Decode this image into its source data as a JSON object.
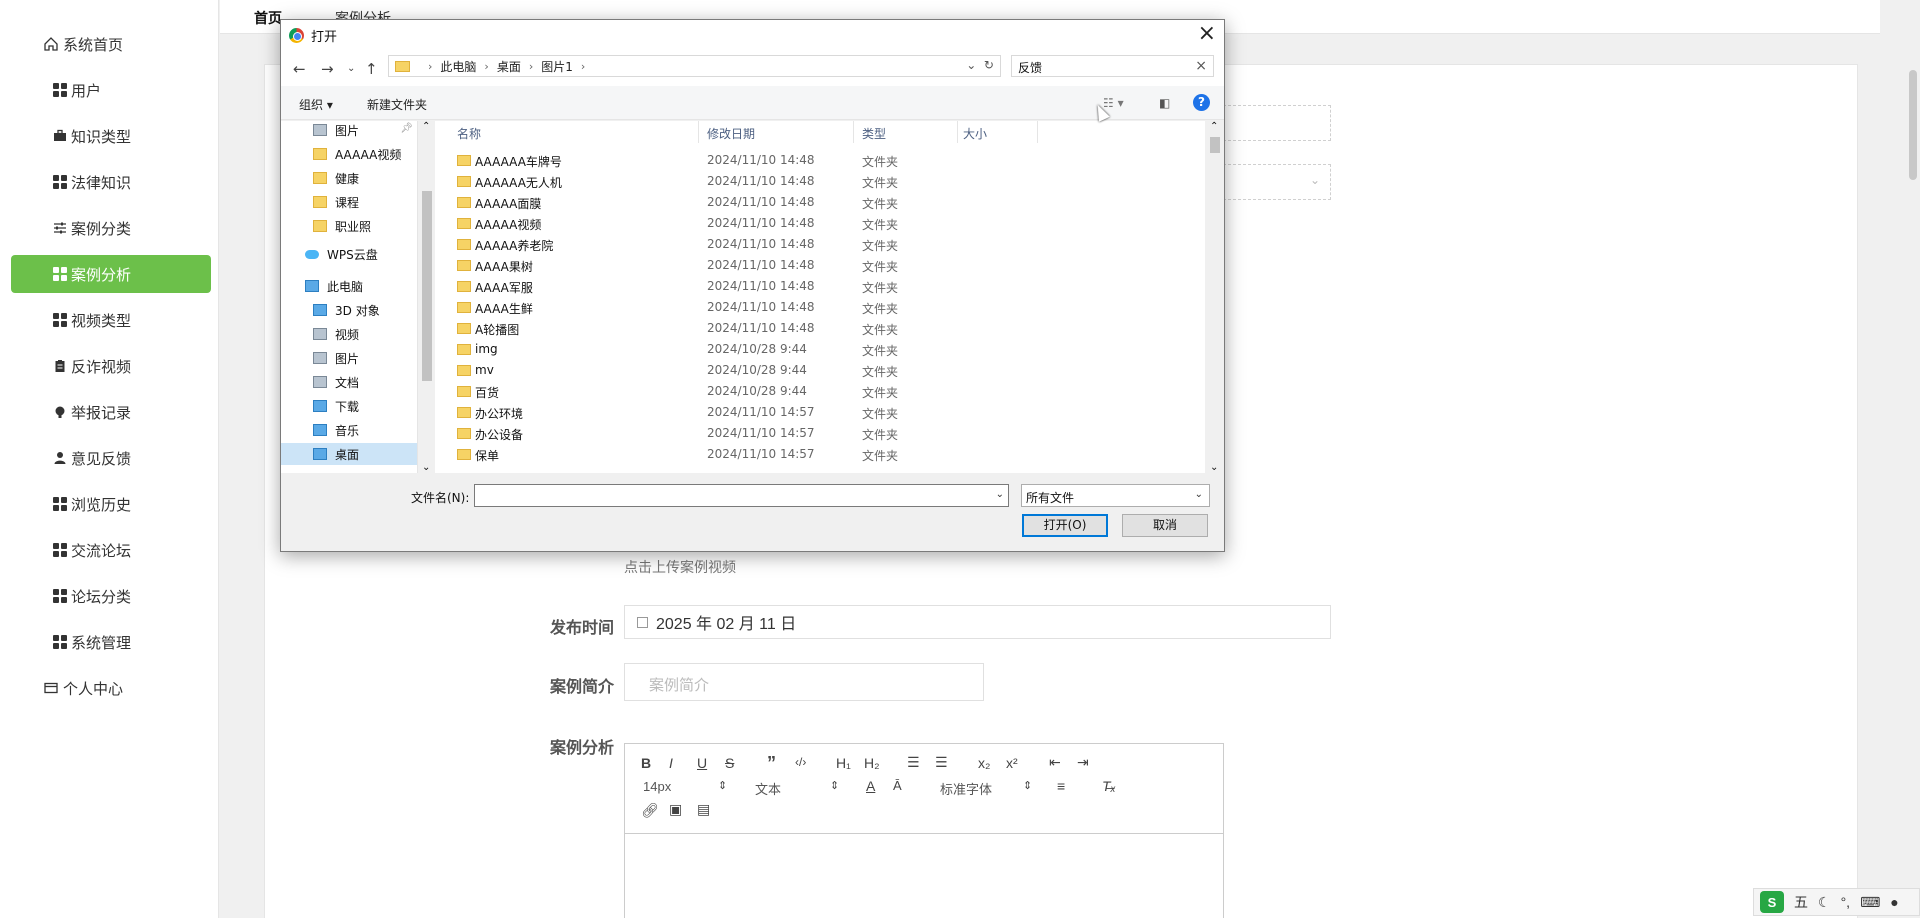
{
  "sidebar": {
    "items": [
      {
        "label": "系统首页",
        "icon": "home-icon",
        "active": false
      },
      {
        "label": "用户",
        "icon": "grid-icon",
        "active": false
      },
      {
        "label": "知识类型",
        "icon": "briefcase-icon",
        "active": false
      },
      {
        "label": "法律知识",
        "icon": "grid-icon",
        "active": false
      },
      {
        "label": "案例分类",
        "icon": "sliders-icon",
        "active": false
      },
      {
        "label": "案例分析",
        "icon": "grid-icon",
        "active": true
      },
      {
        "label": "视频类型",
        "icon": "grid-icon",
        "active": false
      },
      {
        "label": "反诈视频",
        "icon": "clipboard-icon",
        "active": false
      },
      {
        "label": "举报记录",
        "icon": "bulb-icon",
        "active": false
      },
      {
        "label": "意见反馈",
        "icon": "user-icon",
        "active": false
      },
      {
        "label": "浏览历史",
        "icon": "grid-icon",
        "active": false
      },
      {
        "label": "交流论坛",
        "icon": "grid-icon",
        "active": false
      },
      {
        "label": "论坛分类",
        "icon": "grid-icon",
        "active": false
      },
      {
        "label": "系统管理",
        "icon": "grid-icon",
        "active": false
      },
      {
        "label": "个人中心",
        "icon": "card-icon",
        "active": false
      }
    ],
    "accent": "#6cc04a"
  },
  "breadcrumb": {
    "home": "首页",
    "current": "案例分析"
  },
  "form": {
    "upload_hint": "点击上传案例视频",
    "publish_time_label": "发布时间",
    "publish_time_value": "2025 年 02 月 11 日",
    "summary_label": "案例简介",
    "summary_placeholder": "案例简介",
    "analysis_label": "案例分析",
    "editor": {
      "font_size": "14px",
      "text_style": "文本",
      "font_family": "标准字体"
    }
  },
  "dialog": {
    "title": "打开",
    "path": [
      "此电脑",
      "桌面",
      "图片1"
    ],
    "search_value": "反馈",
    "commands": {
      "organize": "组织 ▾",
      "new_folder": "新建文件夹"
    },
    "tree": [
      {
        "label": "图片",
        "icon": "gray"
      },
      {
        "label": "AAAAA视频",
        "icon": "folder"
      },
      {
        "label": "健康",
        "icon": "folder"
      },
      {
        "label": "课程",
        "icon": "folder"
      },
      {
        "label": "职业照",
        "icon": "folder"
      },
      {
        "label": "WPS云盘",
        "icon": "cloud"
      },
      {
        "label": "此电脑",
        "icon": "blue"
      },
      {
        "label": "3D 对象",
        "icon": "blue"
      },
      {
        "label": "视频",
        "icon": "gray"
      },
      {
        "label": "图片",
        "icon": "gray"
      },
      {
        "label": "文档",
        "icon": "gray"
      },
      {
        "label": "下载",
        "icon": "blue"
      },
      {
        "label": "音乐",
        "icon": "blue"
      },
      {
        "label": "桌面",
        "icon": "blue"
      }
    ],
    "columns": {
      "name": "名称",
      "date": "修改日期",
      "type": "类型",
      "size": "大小"
    },
    "files": [
      {
        "name": "AAAAAA车牌号",
        "date": "2024/11/10 14:48",
        "type": "文件夹"
      },
      {
        "name": "AAAAAA无人机",
        "date": "2024/11/10 14:48",
        "type": "文件夹"
      },
      {
        "name": "AAAAA面膜",
        "date": "2024/11/10 14:48",
        "type": "文件夹"
      },
      {
        "name": "AAAAA视频",
        "date": "2024/11/10 14:48",
        "type": "文件夹"
      },
      {
        "name": "AAAAA养老院",
        "date": "2024/11/10 14:48",
        "type": "文件夹"
      },
      {
        "name": "AAAA果树",
        "date": "2024/11/10 14:48",
        "type": "文件夹"
      },
      {
        "name": "AAAA军服",
        "date": "2024/11/10 14:48",
        "type": "文件夹"
      },
      {
        "name": "AAAA生鲜",
        "date": "2024/11/10 14:48",
        "type": "文件夹"
      },
      {
        "name": "A轮播图",
        "date": "2024/11/10 14:48",
        "type": "文件夹"
      },
      {
        "name": "img",
        "date": "2024/10/28 9:44",
        "type": "文件夹"
      },
      {
        "name": "mv",
        "date": "2024/10/28 9:44",
        "type": "文件夹"
      },
      {
        "name": "百货",
        "date": "2024/10/28 9:44",
        "type": "文件夹"
      },
      {
        "name": "办公环境",
        "date": "2024/11/10 14:57",
        "type": "文件夹"
      },
      {
        "name": "办公设备",
        "date": "2024/11/10 14:57",
        "type": "文件夹"
      },
      {
        "name": "保单",
        "date": "2024/11/10 14:57",
        "type": "文件夹"
      }
    ],
    "filename_label": "文件名(N):",
    "filename_value": "",
    "filter_value": "所有文件",
    "open_button": "打开(O)",
    "cancel_button": "取消"
  },
  "ime": {
    "logo": "S",
    "mode": "五"
  }
}
